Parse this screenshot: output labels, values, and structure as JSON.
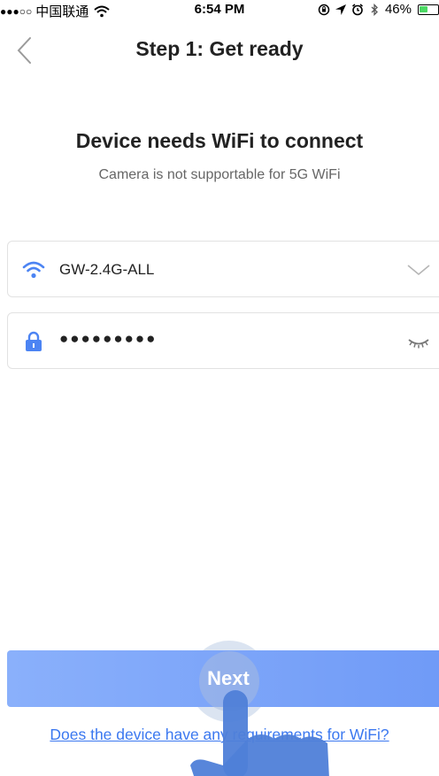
{
  "status_bar": {
    "signal": "●●●○○",
    "carrier": "中国联通",
    "time": "6:54 PM",
    "battery": "46%",
    "battery_level": 0.46
  },
  "nav": {
    "title": "Step 1: Get ready"
  },
  "header": {
    "headline": "Device needs WiFi to connect",
    "subline": "Camera is not supportable for 5G WiFi"
  },
  "wifi_field": {
    "value": "GW-2.4G-ALL"
  },
  "password_field": {
    "value": "●●●●●●●●●"
  },
  "next_button": {
    "label": "Next"
  },
  "wifi_requirements_link": {
    "label": "Does the device have any requirements for WiFi?"
  },
  "colors": {
    "accent": "#3b78f0",
    "button": "#7ea5f9",
    "battery": "#4cd964"
  }
}
